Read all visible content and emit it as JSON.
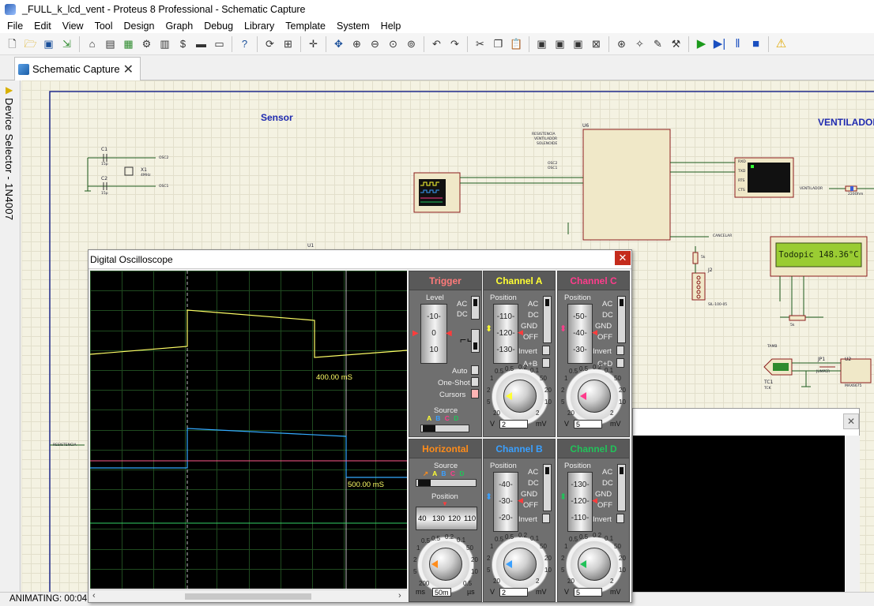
{
  "window": {
    "title": "_FULL_k_lcd_vent - Proteus 8 Professional - Schematic Capture"
  },
  "menu": [
    "File",
    "Edit",
    "View",
    "Tool",
    "Design",
    "Graph",
    "Debug",
    "Library",
    "Template",
    "System",
    "Help"
  ],
  "toolbar": {
    "icons": [
      "new-file-icon",
      "open-folder-icon",
      "save-icon",
      "import-icon",
      "home-icon",
      "schematic-icon",
      "pcb-icon",
      "3d-icon",
      "gerber-icon",
      "bom-icon",
      "netlist-icon",
      "notes-icon",
      "help-icon",
      "refresh-icon",
      "grid-icon",
      "origin-icon",
      "pan-icon",
      "zoom-in-icon",
      "zoom-out-icon",
      "zoom-all-icon",
      "zoom-area-icon",
      "undo-icon",
      "redo-icon",
      "cut-icon",
      "copy-icon",
      "paste-icon",
      "block-copy-icon",
      "block-move-icon",
      "block-rotate-icon",
      "block-delete-icon",
      "pick-device-icon",
      "make-device-icon",
      "packaging-icon",
      "decompose-icon",
      "play-icon",
      "step-icon",
      "pause-icon",
      "stop-icon",
      "warning-icon"
    ]
  },
  "tab": {
    "label": "Schematic Capture"
  },
  "device_selector": {
    "label": "Device Selector - 1N4007"
  },
  "status": {
    "text": "ANIMATING: 00:04:"
  },
  "schematic": {
    "sensor_label": "Sensor",
    "ventilador_label": "VENTILADOR",
    "lcd_text": "Todopic 148.36°C",
    "labels": {
      "u6": "U6",
      "u1": "U1",
      "u2": "U2",
      "j2": "J2",
      "jp1": "JP1",
      "tc1": "TC1",
      "x1": "X1",
      "c1": "C1",
      "c2": "C2",
      "x1_freq": "4MHz",
      "c_value": "15p",
      "osc1": "OSC1",
      "osc2": "OSC2",
      "resistencia": "RESISTENCIA",
      "ventilador_net": "VENTILADOR",
      "solenoide": "SOLENOIDE",
      "cancelar": "CANCELAR",
      "tamb": "TAMB",
      "tc1_type": "TCK",
      "r_220": "220Ohm",
      "r_5k": "5k",
      "jumper": "JUMPER",
      "max6675": "MAX6675",
      "sil_100_05": "SIL-100-05"
    },
    "terminal_labels": [
      "RXD",
      "TXD",
      "RTS",
      "CTS"
    ]
  },
  "oscilloscope": {
    "title": "Digital Oscilloscope",
    "screen": {
      "marker_a": "400.00 mS",
      "marker_b": "500.00 mS"
    },
    "trigger": {
      "title": "Trigger",
      "level_label": "Level",
      "level_ticks": [
        "-10-",
        "0",
        "10"
      ],
      "ac": "AC",
      "dc": "DC",
      "auto": "Auto",
      "one_shot": "One-Shot",
      "cursors": "Cursors",
      "source_label": "Source",
      "source_opts": [
        "A",
        "B",
        "C",
        "D"
      ]
    },
    "horizontal": {
      "title": "Horizontal",
      "source_label": "Source",
      "source_opts": [
        "A",
        "B",
        "C",
        "D"
      ],
      "position_label": "Position",
      "position_ticks": [
        "40",
        "130",
        "120",
        "110"
      ],
      "knob_ticks": [
        "0.5",
        "0.2",
        "0.1",
        "50",
        "20",
        "10",
        "5",
        "2",
        "1",
        "0.5",
        "200",
        "0.5"
      ],
      "value": "50m",
      "unit_left": "ms",
      "unit_right": "µs"
    },
    "channels": [
      {
        "id": "a",
        "title": "Channel A",
        "color": "#ffff33",
        "position_ticks": [
          "-110-",
          "-120-",
          "-130-"
        ],
        "coupling": [
          "AC",
          "DC",
          "GND",
          "OFF"
        ],
        "invert": "Invert",
        "extra": "A+B",
        "value": "2",
        "unit_left": "V",
        "unit_right": "mV",
        "knob_ticks": [
          "0.5",
          "0.2",
          "0.1",
          "50",
          "20",
          "10",
          "5",
          "2",
          "1",
          "0.5",
          "20",
          "2"
        ]
      },
      {
        "id": "c",
        "title": "Channel C",
        "color": "#ff3c8c",
        "position_ticks": [
          "-50-",
          "-40-",
          "-30-"
        ],
        "coupling": [
          "AC",
          "DC",
          "GND",
          "OFF"
        ],
        "invert": "Invert",
        "extra": "C+D",
        "value": "5",
        "unit_left": "V",
        "unit_right": "mV",
        "knob_ticks": [
          "0.5",
          "0.2",
          "0.1",
          "50",
          "20",
          "10",
          "5",
          "2",
          "1",
          "0.5",
          "20",
          "2"
        ]
      },
      {
        "id": "b",
        "title": "Channel B",
        "color": "#3aa0ff",
        "position_ticks": [
          "-40-",
          "-30-",
          "-20-"
        ],
        "coupling": [
          "AC",
          "DC",
          "GND",
          "OFF"
        ],
        "invert": "Invert",
        "value": "2",
        "unit_left": "V",
        "unit_right": "mV",
        "knob_ticks": [
          "0.5",
          "0.2",
          "0.1",
          "50",
          "20",
          "10",
          "5",
          "2",
          "1",
          "0.5",
          "20",
          "2"
        ]
      },
      {
        "id": "d",
        "title": "Channel D",
        "color": "#22c25a",
        "position_ticks": [
          "-130-",
          "-120-",
          "-110-"
        ],
        "coupling": [
          "AC",
          "DC",
          "GND",
          "OFF"
        ],
        "invert": "Invert",
        "value": "5",
        "unit_left": "V",
        "unit_right": "mV",
        "knob_ticks": [
          "0.5",
          "0.2",
          "0.1",
          "50",
          "20",
          "10",
          "5",
          "2",
          "1",
          "0.5",
          "20",
          "2"
        ]
      }
    ]
  }
}
